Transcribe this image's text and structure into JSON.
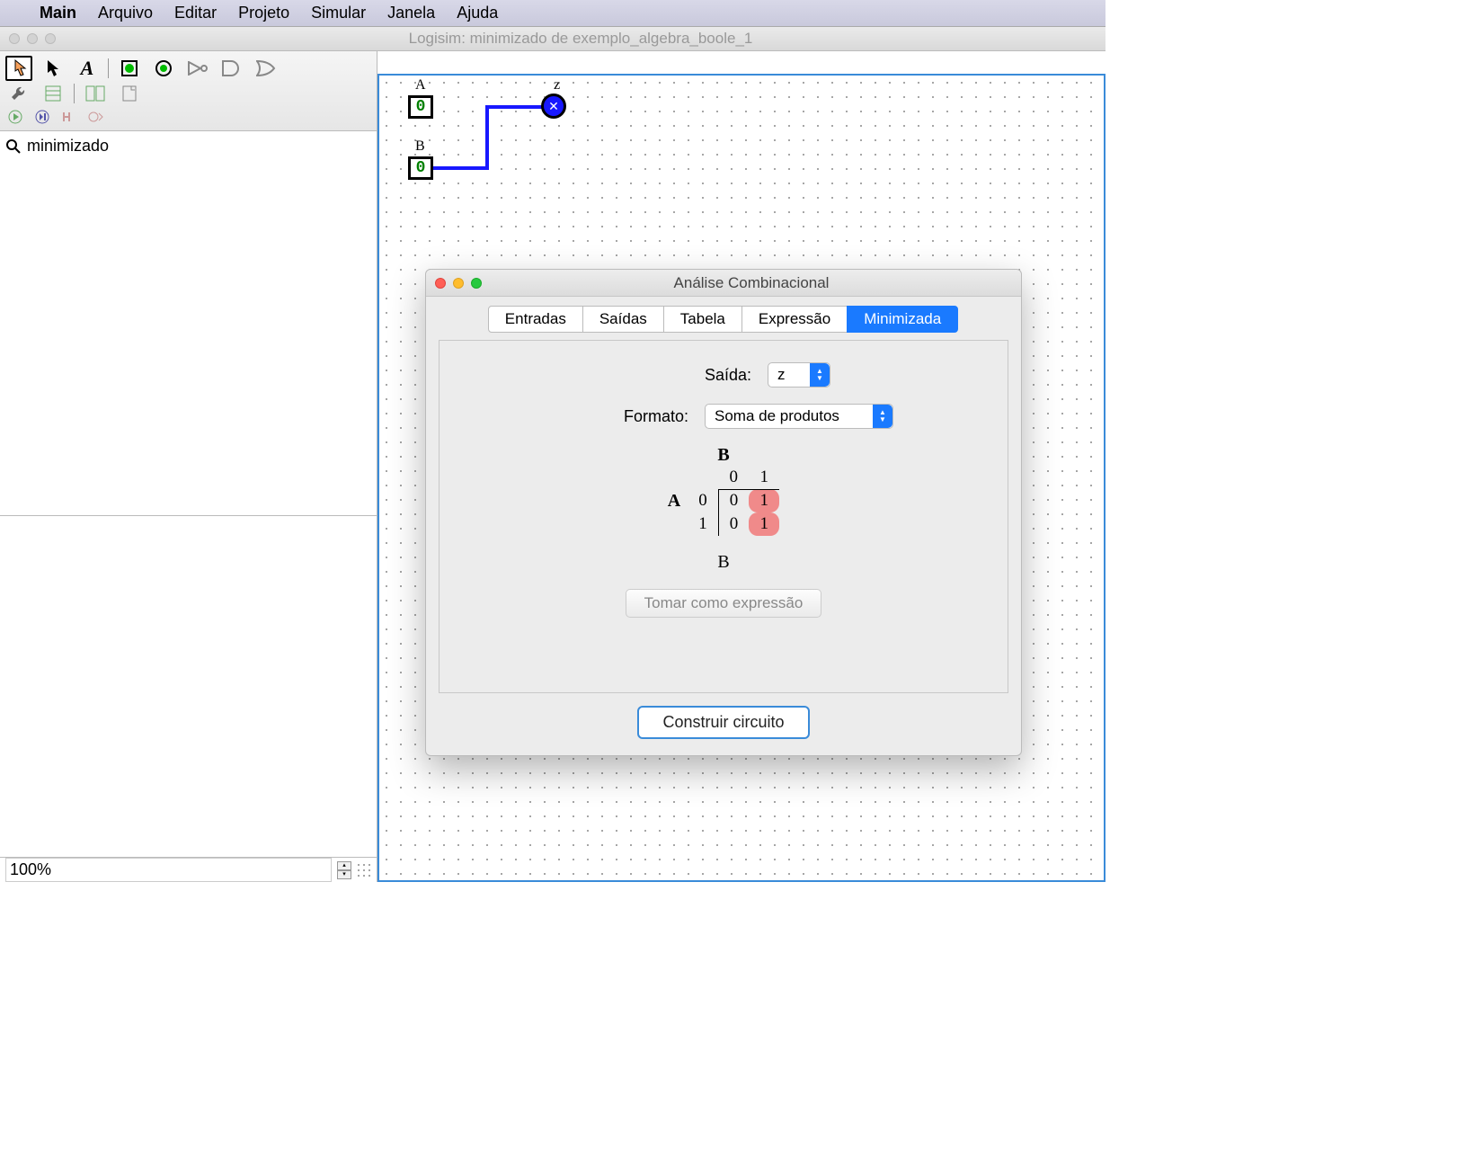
{
  "menubar": {
    "apple": "",
    "app": "Main",
    "items": [
      "Arquivo",
      "Editar",
      "Projeto",
      "Simular",
      "Janela",
      "Ajuda"
    ]
  },
  "window": {
    "title": "Logisim: minimizado de exemplo_algebra_boole_1"
  },
  "tree": {
    "item0": "minimizado"
  },
  "zoom": {
    "value": "100%"
  },
  "circuit": {
    "pinA_label": "A",
    "pinA_val": "0",
    "pinB_label": "B",
    "pinB_val": "0",
    "out_label": "z",
    "out_symbol": "✕"
  },
  "dialog": {
    "title": "Análise Combinacional",
    "tabs": [
      "Entradas",
      "Saídas",
      "Tabela",
      "Expressão",
      "Minimizada"
    ],
    "active_tab_index": 4,
    "output_label": "Saída:",
    "output_value": "z",
    "format_label": "Formato:",
    "format_value": "Soma de produtos",
    "kmap": {
      "top_var": "B",
      "side_var": "A",
      "col_headers": [
        "0",
        "1"
      ],
      "row_headers": [
        "0",
        "1"
      ],
      "cells": [
        [
          "0",
          "1"
        ],
        [
          "0",
          "1"
        ]
      ],
      "highlight": [
        [
          false,
          true
        ],
        [
          false,
          true
        ]
      ]
    },
    "result": "B",
    "take_expr_btn": "Tomar como expressão",
    "build_btn": "Construir circuito"
  },
  "colors": {
    "accent": "#1a7aff",
    "wire": "#1818ff",
    "highlight": "#f08a8a"
  }
}
